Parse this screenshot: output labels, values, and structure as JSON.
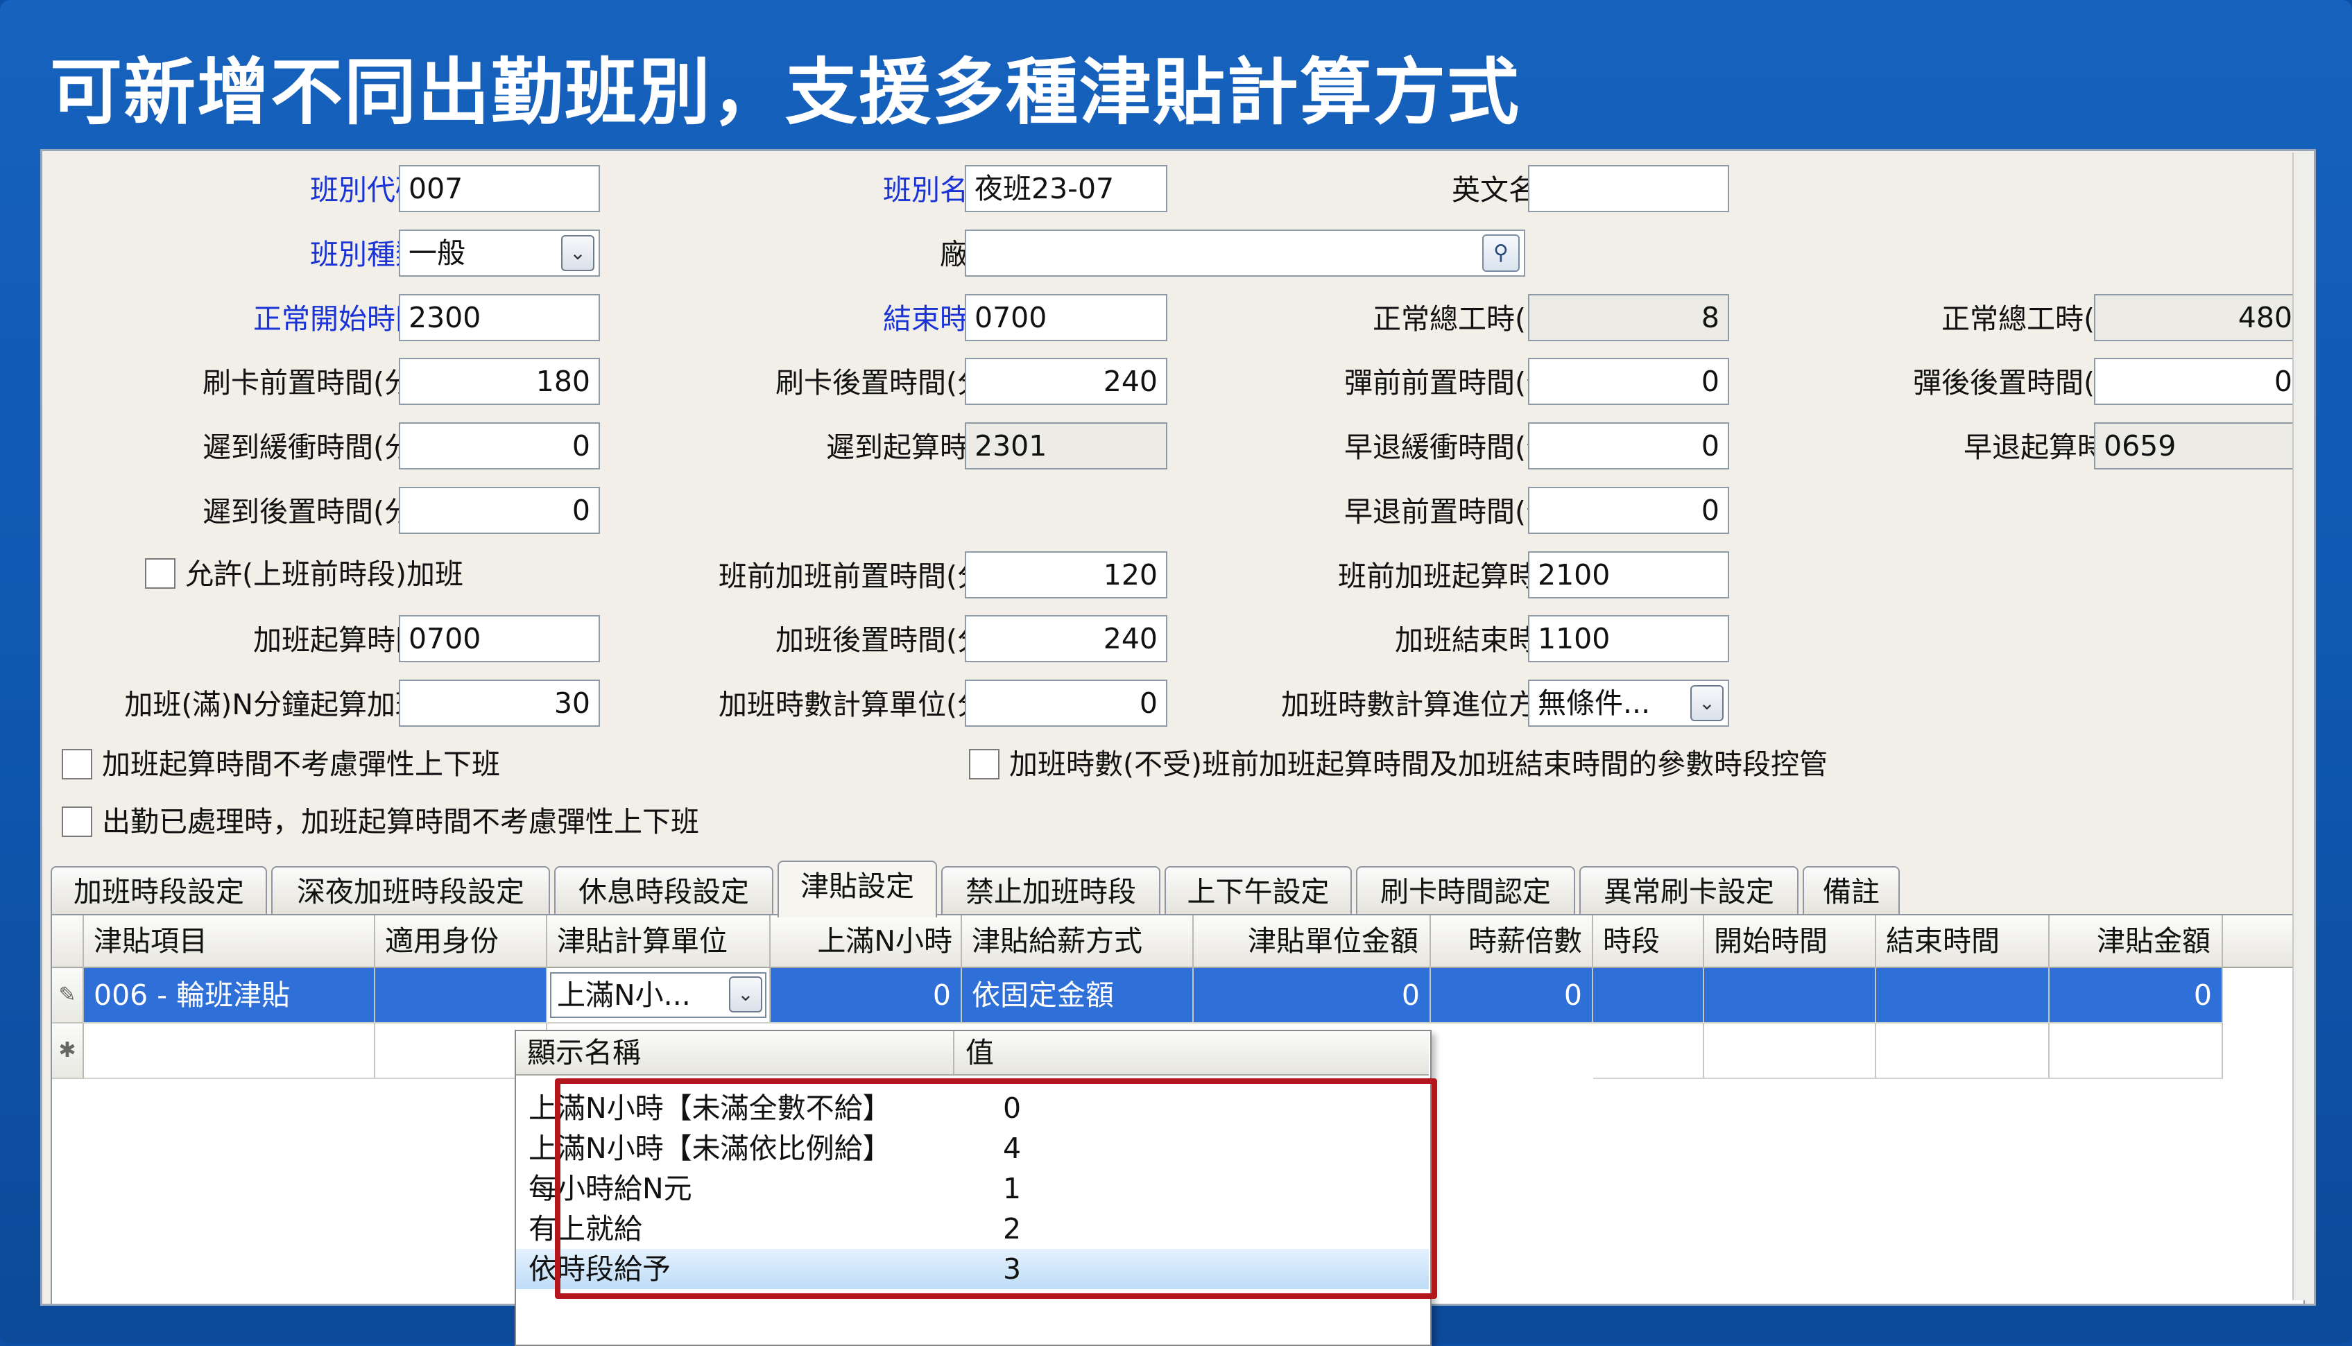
{
  "banner": {
    "title": "可新增不同出勤班別，支援多種津貼計算方式"
  },
  "form": {
    "shift_code": {
      "label": "班別代碼",
      "value": "007"
    },
    "shift_name": {
      "label": "班別名稱",
      "value": "夜班23-07"
    },
    "english_name": {
      "label": "英文名稱",
      "value": ""
    },
    "shift_type": {
      "label": "班別種類",
      "value": "一般"
    },
    "factory": {
      "label": "廠別",
      "value": ""
    },
    "normal_start": {
      "label": "正常開始時間",
      "value": "2300"
    },
    "end_time": {
      "label": "結束時間",
      "value": "0700"
    },
    "normal_hours": {
      "label": "正常總工時(時)",
      "value": "8"
    },
    "normal_minutes": {
      "label": "正常總工時(分)",
      "value": "480"
    },
    "punch_before": {
      "label": "刷卡前置時間(分)",
      "value": "180"
    },
    "punch_after": {
      "label": "刷卡後置時間(分)",
      "value": "240"
    },
    "flex_before_pre": {
      "label": "彈前前置時間(分)",
      "value": "0"
    },
    "flex_after_post": {
      "label": "彈後後置時間(分)",
      "value": "0"
    },
    "late_buffer": {
      "label": "遲到緩衝時間(分)",
      "value": "0"
    },
    "late_start": {
      "label": "遲到起算時間",
      "value": "2301"
    },
    "early_buffer": {
      "label": "早退緩衝時間(分)",
      "value": "0"
    },
    "early_start": {
      "label": "早退起算時間",
      "value": "0659"
    },
    "late_post": {
      "label": "遲到後置時間(分)",
      "value": "0"
    },
    "early_pre": {
      "label": "早退前置時間(分)",
      "value": "0"
    },
    "allow_pre_ot": {
      "label": "允許(上班前時段)加班",
      "checked": false
    },
    "pre_ot_pre_time": {
      "label": "班前加班前置時間(分)",
      "value": "120"
    },
    "pre_ot_start": {
      "label": "班前加班起算時間",
      "value": "2100"
    },
    "ot_start": {
      "label": "加班起算時間",
      "value": "0700"
    },
    "ot_post": {
      "label": "加班後置時間(分)",
      "value": "240"
    },
    "ot_end": {
      "label": "加班結束時間",
      "value": "1100"
    },
    "ot_full_n": {
      "label": "加班(滿)N分鐘起算加班",
      "value": "30"
    },
    "ot_unit": {
      "label": "加班時數計算單位(分)",
      "value": "0"
    },
    "ot_round": {
      "label": "加班時數計算進位方式",
      "value": "無條件..."
    },
    "chk_ot_ignore_flex": {
      "label": "加班起算時間不考慮彈性上下班",
      "checked": false
    },
    "chk_ot_hours_unrestricted": {
      "label": "加班時數(不受)班前加班起算時間及加班結束時間的參數時段控管",
      "checked": false
    },
    "chk_attendance_processed": {
      "label": "出勤已處理時，加班起算時間不考慮彈性上下班",
      "checked": false
    }
  },
  "tabs": [
    "加班時段設定",
    "深夜加班時段設定",
    "休息時段設定",
    "津貼設定",
    "禁止加班時段",
    "上下午設定",
    "刷卡時間認定",
    "異常刷卡設定",
    "備註"
  ],
  "active_tab": "津貼設定",
  "grid": {
    "columns": [
      "津貼項目",
      "適用身份",
      "津貼計算單位",
      "上滿N小時",
      "津貼給薪方式",
      "津貼單位金額",
      "時薪倍數",
      "時段",
      "開始時間",
      "結束時間",
      "津貼金額"
    ],
    "rows": [
      {
        "item": "006 - 輪班津貼",
        "identity": "",
        "calc_unit": "上滿N小...",
        "n_hours": "0",
        "pay_method": "依固定金額",
        "unit_amount": "0",
        "hourly_multiple": "0",
        "period": "",
        "start": "",
        "end": "",
        "amount": "0"
      }
    ]
  },
  "dropdown": {
    "headers": [
      "顯示名稱",
      "值"
    ],
    "options": [
      {
        "name": "上滿N小時【未滿全數不給】",
        "value": "0"
      },
      {
        "name": "上滿N小時【未滿依比例給】",
        "value": "4"
      },
      {
        "name": "每小時給N元",
        "value": "1"
      },
      {
        "name": "有上就給",
        "value": "2"
      },
      {
        "name": "依時段給予",
        "value": "3"
      }
    ],
    "highlighted_index": 4
  },
  "colors": {
    "banner": "#1662bd",
    "selection": "#2f6fd8",
    "highlight_box": "#b4161e",
    "required_label": "#1a33d6"
  }
}
